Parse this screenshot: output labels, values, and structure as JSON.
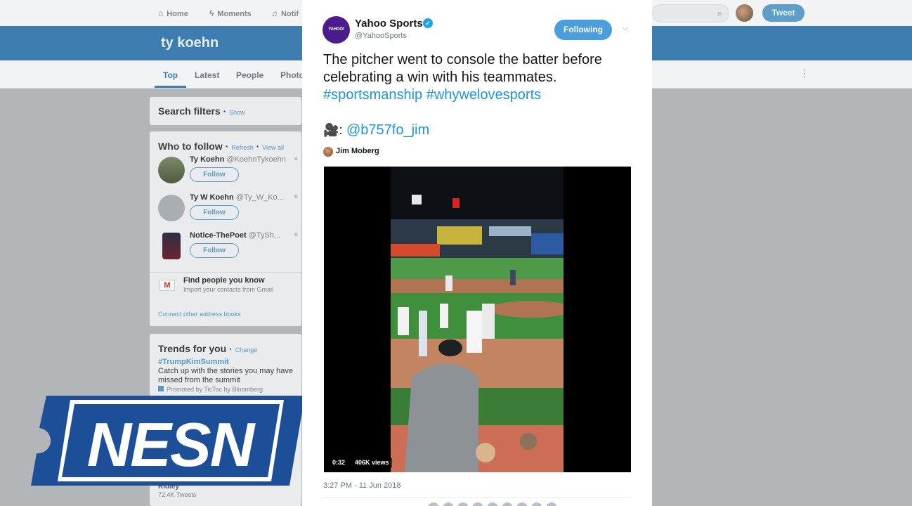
{
  "topnav": {
    "home": "Home",
    "moments": "Moments",
    "notifications": "Notif",
    "tweet_button": "Tweet"
  },
  "search": {
    "query": "ty koehn"
  },
  "tabs": [
    "Top",
    "Latest",
    "People",
    "Photo"
  ],
  "search_filters": {
    "title": "Search filters",
    "show": "Show"
  },
  "who_to_follow": {
    "title": "Who to follow",
    "refresh": "Refresh",
    "view_all": "View all",
    "users": [
      {
        "name": "Ty Koehn",
        "handle": "@KoehnTykoehn",
        "action": "Follow"
      },
      {
        "name": "Ty W Koehn",
        "handle": "@Ty_W_Ko...",
        "action": "Follow"
      },
      {
        "name": "Notice-ThePoet",
        "handle": "@TySh...",
        "action": "Follow"
      }
    ],
    "find_people": {
      "title": "Find people you know",
      "subtitle": "Import your contacts from Gmail"
    },
    "connect": "Connect other address books"
  },
  "trends": {
    "title": "Trends for you",
    "change": "Change",
    "items": [
      {
        "tag": "#TrumpKimSummit",
        "description": "Catch up with the stories you may have missed from the summit",
        "promoted": "Promoted by TicToc by Bloomberg"
      }
    ],
    "partial_name": "Ridley",
    "partial_count": "72.4K Tweets"
  },
  "tweet": {
    "avatar_text": "YAHOO! SPORTS",
    "author_name": "Yahoo Sports",
    "author_handle": "@YahooSports",
    "following_label": "Following",
    "text": "The pitcher went to console the batter before celebrating a win with his teammates.",
    "hashtags": "#sportsmanship #whywelovesports",
    "credit_prefix": "🎥:",
    "credit_handle": "@b757fo_jim",
    "video_author": "Jim Moberg",
    "video": {
      "duration": "0:32",
      "views": "406K views"
    },
    "timestamp": "3:27 PM - 11 Jun 2018"
  },
  "logo": {
    "text": "NESN"
  },
  "colors": {
    "twitter_blue": "#1da1f2",
    "link_blue": "#1b95e0",
    "banner_blue": "#3d7db0",
    "nesn_blue": "#1c4f97",
    "yahoo_purple": "#4b1c8c"
  }
}
